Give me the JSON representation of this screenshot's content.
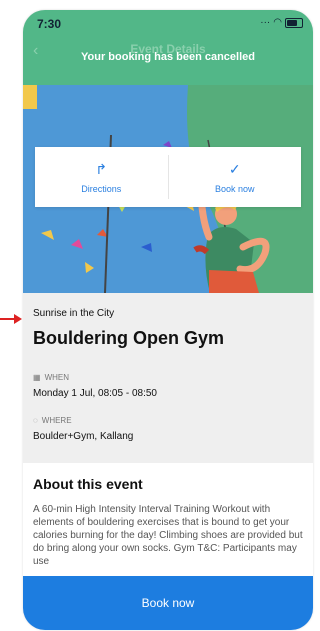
{
  "status": {
    "time": "7:30"
  },
  "header": {
    "title": "Event Details",
    "toast": "Your booking has been cancelled"
  },
  "actions": {
    "directions_label": "Directions",
    "book_label": "Book now"
  },
  "event": {
    "subtitle": "Sunrise in the City",
    "title": "Bouldering Open Gym",
    "when_label": "WHEN",
    "when_value": "Monday 1 Jul, 08:05 - 08:50",
    "where_label": "WHERE",
    "where_value": "Boulder+Gym, Kallang"
  },
  "about": {
    "title": "About this event",
    "text": "A 60-min High Intensity Interval Training Workout with elements of bouldering exercises that is bound to get your calories burning for the day! Climbing shoes are provided but do bring along your own socks. Gym T&C: Participants may use"
  },
  "footer": {
    "book_label": "Book now"
  },
  "colors": {
    "header": "#52b788",
    "primary": "#1d7de0"
  }
}
